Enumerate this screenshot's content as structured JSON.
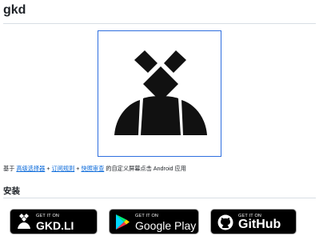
{
  "page": {
    "title": "gkd"
  },
  "description": {
    "prefix": "基于 ",
    "link1": "高级选择器",
    "sep1": " + ",
    "link2": "订阅规则",
    "sep2": " + ",
    "link3": "快照审查",
    "suffix": " 的自定义屏幕点击 Android 应用"
  },
  "install": {
    "heading": "安装",
    "badges": [
      {
        "small": "GET IT ON",
        "big": "GKD.LI",
        "icon": "gkd-icon"
      },
      {
        "small": "GET IT ON",
        "big": "Google Play",
        "icon": "google-play-icon"
      },
      {
        "small": "GET IT ON",
        "big": "GitHub",
        "icon": "github-icon"
      }
    ]
  },
  "colors": {
    "link": "#0969da",
    "logo_border": "#2f6fdf",
    "badge_bg": "#000000"
  }
}
